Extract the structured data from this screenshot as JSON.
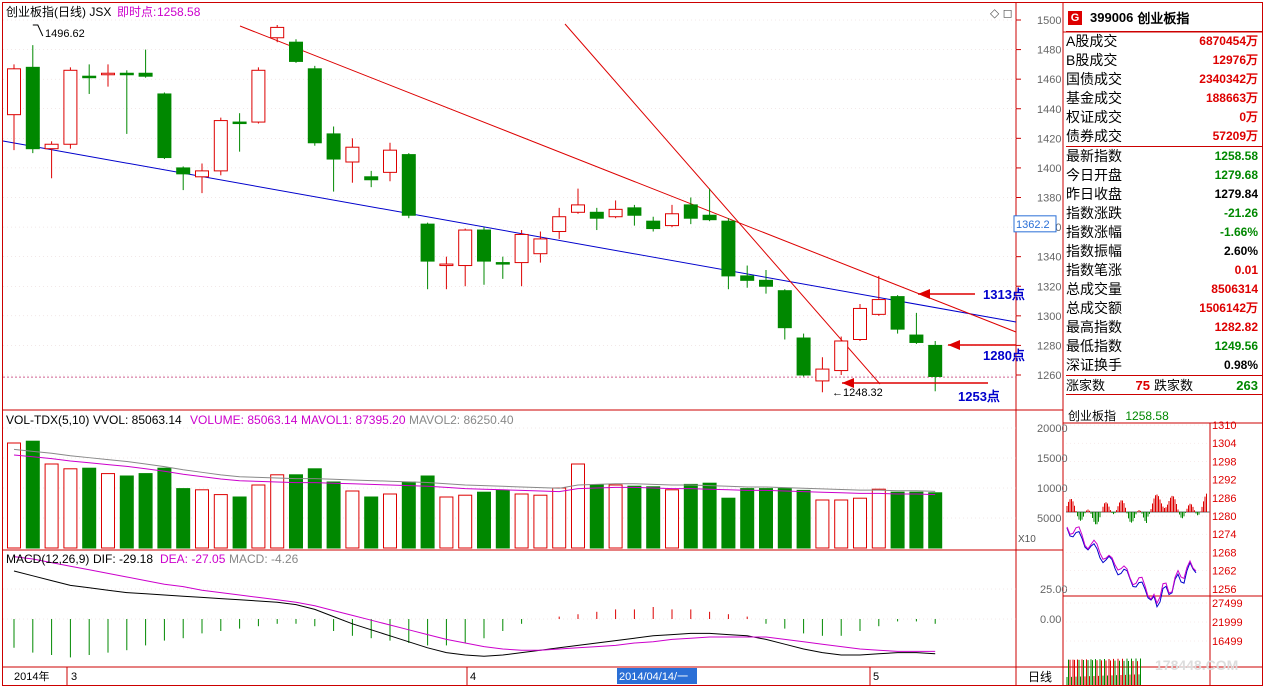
{
  "header": {
    "title": "创业板指(日线) JSX",
    "realtime_label": "即时点:",
    "realtime_value": "1258.58",
    "peak_label": "1496.62",
    "low_label": "1248.32",
    "price_tag": "1362.2"
  },
  "annotations": {
    "a1313": "1313点",
    "a1280": "1280点",
    "a1253": "1253点"
  },
  "vol_header": {
    "title": "VOL-TDX(5,10)",
    "vvol": "VVOL: 85063.14",
    "volume": "VOLUME: 85063.14",
    "mavol1": "MAVOL1: 87395.20",
    "mavol2": "MAVOL2: 86250.40",
    "x10": "X10"
  },
  "macd_header": {
    "title": "MACD(12,26,9)",
    "dif": "DIF: -29.18",
    "dea": "DEA: -27.05",
    "macd": "MACD: -4.26"
  },
  "xaxis": {
    "year": "2014年",
    "m3": "3",
    "m4": "4",
    "m5": "5",
    "cursor_date": "2014/04/14/一",
    "period": "日线"
  },
  "side": {
    "code": "399006",
    "name": "创业板指",
    "badge": "G",
    "rows1": [
      {
        "k": "A股成交",
        "v": "6870454",
        "u": "万"
      },
      {
        "k": "B股成交",
        "v": "12976",
        "u": "万"
      },
      {
        "k": "国债成交",
        "v": "2340342",
        "u": "万"
      },
      {
        "k": "基金成交",
        "v": "188663",
        "u": "万"
      },
      {
        "k": "权证成交",
        "v": "0",
        "u": "万"
      },
      {
        "k": "债券成交",
        "v": "57209",
        "u": "万"
      }
    ],
    "rows2": [
      {
        "k": "最新指数",
        "v": "1258.58",
        "c": "green"
      },
      {
        "k": "今日开盘",
        "v": "1279.68",
        "c": "green"
      },
      {
        "k": "昨日收盘",
        "v": "1279.84",
        "c": "black"
      },
      {
        "k": "指数涨跌",
        "v": "-21.26",
        "c": "green"
      },
      {
        "k": "指数涨幅",
        "v": "-1.66%",
        "c": "green"
      },
      {
        "k": "指数振幅",
        "v": "2.60%",
        "c": "black"
      },
      {
        "k": "指数笔涨",
        "v": "0.01",
        "c": "red"
      },
      {
        "k": "总成交量",
        "v": "8506314",
        "c": "red"
      },
      {
        "k": "总成交额",
        "v": "1506142",
        "u": "万",
        "c": "red"
      },
      {
        "k": "最高指数",
        "v": "1282.82",
        "c": "red"
      },
      {
        "k": "最低指数",
        "v": "1249.56",
        "c": "green"
      },
      {
        "k": "深证换手",
        "v": "0.98%",
        "c": "black"
      }
    ],
    "up_label": "涨家数",
    "up_value": "75",
    "down_label": "跌家数",
    "down_value": "263",
    "mini_title": "创业板指",
    "mini_value": "1258.58",
    "mini_ticks": [
      "1310",
      "1304",
      "1298",
      "1292",
      "1286",
      "1280",
      "1274",
      "1268",
      "1262",
      "1256",
      "27499",
      "21999",
      "16499"
    ]
  },
  "watermark": "178448.COM",
  "chart_data": {
    "type": "candlestick",
    "price_ticks": [
      1500,
      1480,
      1460,
      1440,
      1420,
      1400,
      1380,
      1360,
      1340,
      1320,
      1300,
      1280,
      1260
    ],
    "vol_ticks": [
      20000,
      15000,
      10000,
      5000
    ],
    "macd_ticks": [
      25,
      0
    ],
    "candles": [
      [
        1436,
        1467,
        1470,
        1412,
        "u"
      ],
      [
        1468,
        1413,
        1483,
        1410,
        "d"
      ],
      [
        1413,
        1416,
        1418,
        1393,
        "u"
      ],
      [
        1416,
        1466,
        1468,
        1413,
        "u"
      ],
      [
        1462,
        1462,
        1470,
        1450,
        "d"
      ],
      [
        1463,
        1464,
        1470,
        1455,
        "u"
      ],
      [
        1464,
        1464,
        1466,
        1423,
        "d"
      ],
      [
        1464,
        1462,
        1480,
        1461,
        "d"
      ],
      [
        1450,
        1407,
        1451,
        1406,
        "d"
      ],
      [
        1400,
        1396,
        1401,
        1385,
        "d"
      ],
      [
        1394,
        1398,
        1403,
        1383,
        "u"
      ],
      [
        1398,
        1432,
        1434,
        1395,
        "u"
      ],
      [
        1431,
        1431,
        1437,
        1411,
        "d"
      ],
      [
        1431,
        1466,
        1468,
        1430,
        "u"
      ],
      [
        1488,
        1495,
        1496.62,
        1485,
        "u"
      ],
      [
        1485,
        1472,
        1487,
        1471,
        "d"
      ],
      [
        1467,
        1417,
        1469,
        1415,
        "d"
      ],
      [
        1423,
        1406,
        1428,
        1384,
        "d"
      ],
      [
        1404,
        1414,
        1420,
        1390,
        "u"
      ],
      [
        1392,
        1394,
        1398,
        1387,
        "d"
      ],
      [
        1397,
        1412,
        1417,
        1391,
        "u"
      ],
      [
        1409,
        1368,
        1410,
        1366,
        "d"
      ],
      [
        1362,
        1337,
        1363,
        1318,
        "d"
      ],
      [
        1335,
        1335,
        1340,
        1318,
        "u"
      ],
      [
        1334,
        1358,
        1359,
        1320,
        "u"
      ],
      [
        1358,
        1337,
        1360,
        1321,
        "d"
      ],
      [
        1335,
        1336,
        1340,
        1325,
        "d"
      ],
      [
        1336,
        1355,
        1358,
        1320,
        "u"
      ],
      [
        1342,
        1352,
        1357,
        1336,
        "u"
      ],
      [
        1357,
        1367,
        1373,
        1352,
        "u"
      ],
      [
        1370,
        1375,
        1386,
        1369,
        "u"
      ],
      [
        1370,
        1366,
        1373,
        1358,
        "d"
      ],
      [
        1367,
        1372,
        1378,
        1366,
        "u"
      ],
      [
        1373,
        1368,
        1375,
        1361,
        "d"
      ],
      [
        1364,
        1359,
        1367,
        1357,
        "d"
      ],
      [
        1361,
        1369,
        1375,
        1360,
        "u"
      ],
      [
        1375,
        1366,
        1380,
        1362,
        "d"
      ],
      [
        1368,
        1365,
        1386,
        1364,
        "d"
      ],
      [
        1364,
        1327,
        1366,
        1318,
        "d"
      ],
      [
        1327,
        1324,
        1334,
        1319,
        "d"
      ],
      [
        1324,
        1320,
        1331,
        1315,
        "d"
      ],
      [
        1317,
        1292,
        1318,
        1284,
        "d"
      ],
      [
        1285,
        1260,
        1288,
        1259,
        "d"
      ],
      [
        1256,
        1264,
        1272,
        1248.32,
        "u"
      ],
      [
        1263,
        1283,
        1286,
        1260,
        "u"
      ],
      [
        1284,
        1305,
        1308,
        1283,
        "u"
      ],
      [
        1301,
        1311,
        1327,
        1300,
        "u"
      ],
      [
        1313,
        1291,
        1314,
        1288,
        "d"
      ],
      [
        1287,
        1282,
        1302,
        1281,
        "d"
      ],
      [
        1280,
        1259,
        1283,
        1249,
        "d"
      ]
    ],
    "volume": [
      17500,
      17800,
      14000,
      13200,
      13300,
      12400,
      12000,
      12400,
      13300,
      9900,
      9700,
      8900,
      8500,
      10500,
      12200,
      12200,
      13200,
      11000,
      9500,
      8500,
      9000,
      11000,
      12000,
      8500,
      8800,
      9300,
      9600,
      9000,
      8800,
      10000,
      14000,
      10500,
      10500,
      10300,
      10200,
      9700,
      10600,
      10800,
      8300,
      9900,
      9900,
      9900,
      9600,
      8000,
      8000,
      8300,
      9800,
      9300,
      9300,
      9200
    ],
    "mavol": [
      15500,
      15200,
      14900,
      14500,
      14200,
      13900,
      13600,
      13200,
      12800,
      12300,
      11900,
      11500,
      11200,
      11100,
      11000,
      10900,
      10900,
      10800,
      10700,
      10600,
      10500,
      10400,
      10300,
      10100,
      9900,
      9800,
      9700,
      9600,
      9500,
      9400,
      9900,
      10000,
      10100,
      10100,
      10000,
      9900,
      9900,
      9800,
      9700,
      9600,
      9600,
      9500,
      9400,
      9300,
      9200,
      9100,
      9100,
      9000,
      9000,
      8900
    ],
    "dif": [
      40,
      36,
      32,
      28,
      26,
      24,
      22,
      21,
      20,
      19,
      18,
      17,
      16,
      15,
      14,
      12,
      8,
      2,
      -4,
      -9,
      -14,
      -19,
      -24,
      -28,
      -30,
      -31,
      -30,
      -28,
      -26,
      -24,
      -22,
      -20,
      -18,
      -16,
      -14,
      -13,
      -12,
      -12,
      -13,
      -14,
      -17,
      -21,
      -25,
      -28,
      -30,
      -30,
      -29,
      -28,
      -28,
      -29
    ],
    "dea": [
      52,
      50,
      47,
      44,
      41,
      38,
      35,
      32,
      29,
      27,
      24,
      22,
      20,
      18,
      16,
      14,
      11,
      7,
      3,
      -1,
      -5,
      -9,
      -13,
      -17,
      -20,
      -23,
      -25,
      -26,
      -26,
      -25,
      -24,
      -23,
      -22,
      -20,
      -19,
      -17,
      -16,
      -15,
      -15,
      -15,
      -15,
      -17,
      -19,
      -21,
      -23,
      -25,
      -26,
      -27,
      -27,
      -27
    ]
  }
}
